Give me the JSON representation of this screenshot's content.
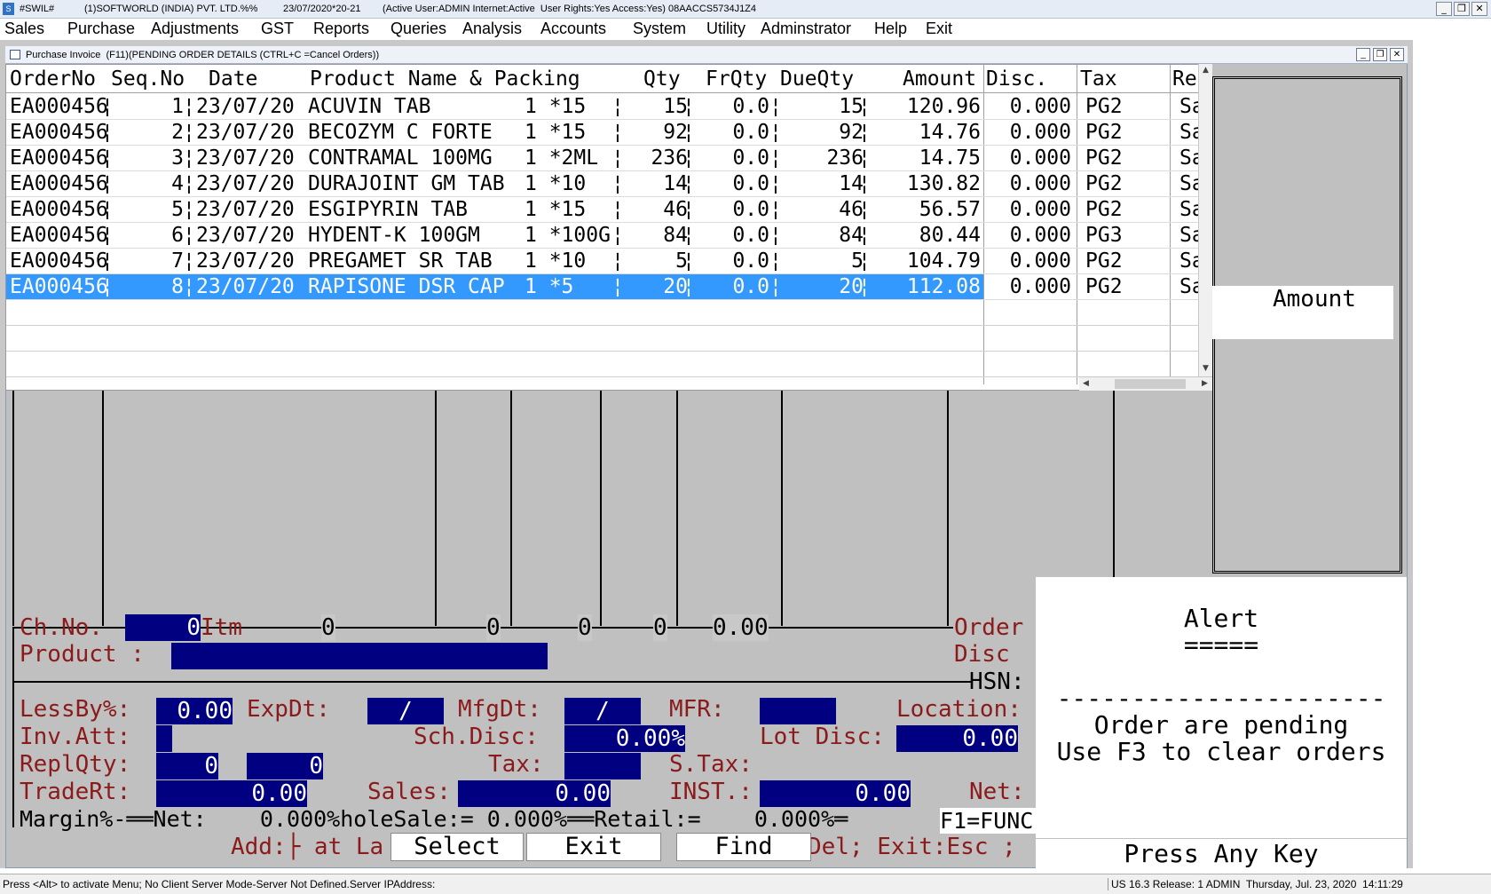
{
  "titlebar": {
    "app": "#SWIL#",
    "company": "(1)SOFTWORLD (INDIA) PVT. LTD.%%",
    "date": "23/07/2020*20-21",
    "status": "(Active User:ADMIN Internet:Active  User Rights:Yes Access:Yes) 08AACCS5734J1Z4",
    "minimize": "_",
    "restore": "❐",
    "close": "✕"
  },
  "menu": {
    "items": [
      "Sales",
      "Purchase",
      "Adjustments",
      "GST",
      "Reports",
      "Queries",
      "Analysis",
      "Accounts",
      "System",
      "Utility",
      "Adminstrator",
      "Help",
      "Exit"
    ]
  },
  "subwindow": {
    "title": "Purchase Invoice  (F11)(PENDING ORDER DETAILS (CTRL+C =Cancel Orders))"
  },
  "grid": {
    "columns": [
      "OrderNo",
      "Seq.No",
      "Date",
      "Product Name & Packing",
      "Qty",
      "FrQty",
      "DueQty",
      "Amount",
      "Disc.",
      "Tax",
      "Re"
    ],
    "rows": [
      {
        "order": "EA000456",
        "seq": "1",
        "date": "23/07/20",
        "product": "ACUVIN TAB",
        "packing": "1 *15",
        "qty": "15",
        "frqty": "0.0",
        "dueqty": "15",
        "amount": "120.96",
        "disc": "0.000",
        "tax": "PG2",
        "re": "Sa"
      },
      {
        "order": "EA000456",
        "seq": "2",
        "date": "23/07/20",
        "product": "BECOZYM C FORTE",
        "packing": "1 *15",
        "qty": "92",
        "frqty": "0.0",
        "dueqty": "92",
        "amount": "14.76",
        "disc": "0.000",
        "tax": "PG2",
        "re": "Sa"
      },
      {
        "order": "EA000456",
        "seq": "3",
        "date": "23/07/20",
        "product": "CONTRAMAL 100MG",
        "packing": "1 *2ML",
        "qty": "236",
        "frqty": "0.0",
        "dueqty": "236",
        "amount": "14.75",
        "disc": "0.000",
        "tax": "PG2",
        "re": "Sa"
      },
      {
        "order": "EA000456",
        "seq": "4",
        "date": "23/07/20",
        "product": "DURAJOINT GM TAB",
        "packing": "1 *10",
        "qty": "14",
        "frqty": "0.0",
        "dueqty": "14",
        "amount": "130.82",
        "disc": "0.000",
        "tax": "PG2",
        "re": "Sa"
      },
      {
        "order": "EA000456",
        "seq": "5",
        "date": "23/07/20",
        "product": "ESGIPYRIN TAB",
        "packing": "1 *15",
        "qty": "46",
        "frqty": "0.0",
        "dueqty": "46",
        "amount": "56.57",
        "disc": "0.000",
        "tax": "PG2",
        "re": "Sa"
      },
      {
        "order": "EA000456",
        "seq": "6",
        "date": "23/07/20",
        "product": "HYDENT-K 100GM",
        "packing": "1 *100G",
        "qty": "84",
        "frqty": "0.0",
        "dueqty": "84",
        "amount": "80.44",
        "disc": "0.000",
        "tax": "PG3",
        "re": "Sa"
      },
      {
        "order": "EA000456",
        "seq": "7",
        "date": "23/07/20",
        "product": "PREGAMET SR TAB",
        "packing": "1 *10",
        "qty": "5",
        "frqty": "0.0",
        "dueqty": "5",
        "amount": "104.79",
        "disc": "0.000",
        "tax": "PG2",
        "re": "Sa"
      },
      {
        "order": "EA000456",
        "seq": "8",
        "date": "23/07/20",
        "product": "RAPISONE DSR CAP",
        "packing": "1 *5",
        "qty": "20",
        "frqty": "0.0",
        "dueqty": "20",
        "amount": "112.08",
        "disc": "0.000",
        "tax": "PG2",
        "re": "Sa"
      }
    ],
    "selected_index": 7
  },
  "amount_panel": {
    "label": "Amount"
  },
  "entry": {
    "chno_label": "Ch.No.",
    "chno_value": "0",
    "itm_label": "Itm",
    "totals": [
      "0",
      "0",
      "0",
      "0",
      "0.00"
    ],
    "order_label": "Order",
    "product_label": "Product :",
    "disc_label": "Disc",
    "hsn_label": "HSN:",
    "lessby_label": "LessBy%:",
    "lessby_value": "0.00",
    "expdt_label": "ExpDt:",
    "expdt_value": "/",
    "mfgdt_label": "MfgDt:",
    "mfgdt_value": "/",
    "mfr_label": "MFR:",
    "location_label": "Location:",
    "invatt_label": "Inv.Att:",
    "schdisc_label": "Sch.Disc:",
    "schdisc_value": "0.00%",
    "lotdisc_label": "Lot Disc:",
    "lotdisc_value": "0.00",
    "replqty_label": "ReplQty:",
    "replqty_value1": "0",
    "replqty_value2": "0",
    "tax_label": "Tax:",
    "stax_label": "S.Tax:",
    "tradert_label": "TradeRt:",
    "tradert_value": "0.00",
    "sales_label": "Sales:",
    "sales_value": "0.00",
    "inst_label": "INST.:",
    "inst_value": "0.00",
    "net_label": "Net:",
    "margin_line": "Margin%-══Net:    0.000%holeSale:= 0.000%══Retail:=    0.000%═",
    "f1_label": "F1=FUNC",
    "add_line": "Add:├ at La",
    "del_line": "Del; Exit:Esc ;"
  },
  "alert": {
    "title": "Alert",
    "underline": "=====",
    "dashes": "----------------------",
    "line1": "Order are pending",
    "line2": "Use F3 to clear orders",
    "press": "Press Any Key"
  },
  "buttons": {
    "select": "Select",
    "exit": "Exit",
    "find": "Find"
  },
  "statusbar": {
    "left": "Press <Alt> to activate Menu; No Client Server Mode-Server Not Defined.Server IPAddress:",
    "right": "US 16.3 Release: 1 ADMIN  Thursday, Jul. 23, 2020  14:11:29"
  },
  "colors": {
    "selection": "#3399ff",
    "field_bg": "#000080",
    "label": "#8b1a1a",
    "panel": "#c0c0c0"
  }
}
